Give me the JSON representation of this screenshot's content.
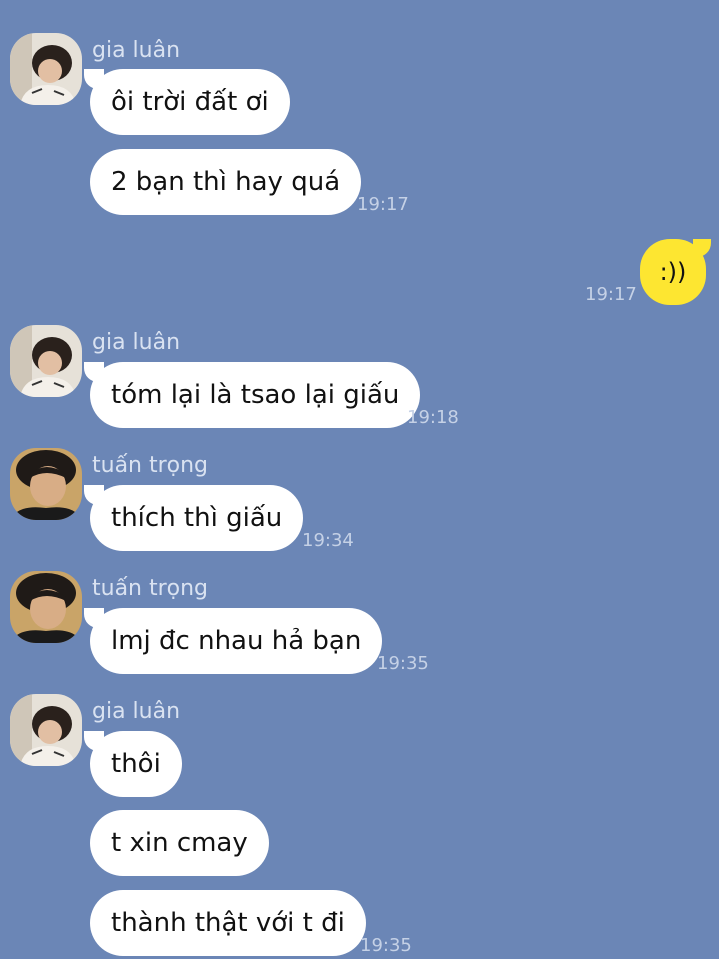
{
  "colors": {
    "background": "#6b86b6",
    "incoming_bubble": "#ffffff",
    "outgoing_bubble": "#fde631"
  },
  "messages": [
    {
      "sender": "gia luân",
      "lines": [
        "ôi trời đất ơi",
        "2 bạn thì hay quá"
      ],
      "time": "19:17"
    },
    {
      "sender": "me",
      "text": ":))",
      "time": "19:17"
    },
    {
      "sender": "gia luân",
      "lines": [
        "tóm lại là tsao lại giấu"
      ],
      "time": "19:18"
    },
    {
      "sender": "tuấn trọng",
      "lines": [
        "thích thì giấu"
      ],
      "time": "19:34"
    },
    {
      "sender": "tuấn trọng",
      "lines": [
        "lmj đc nhau hả bạn"
      ],
      "time": "19:35"
    },
    {
      "sender": "gia luân",
      "lines": [
        "thôi",
        "t xin cmay",
        "thành thật với t đi"
      ],
      "time": "19:35"
    }
  ]
}
